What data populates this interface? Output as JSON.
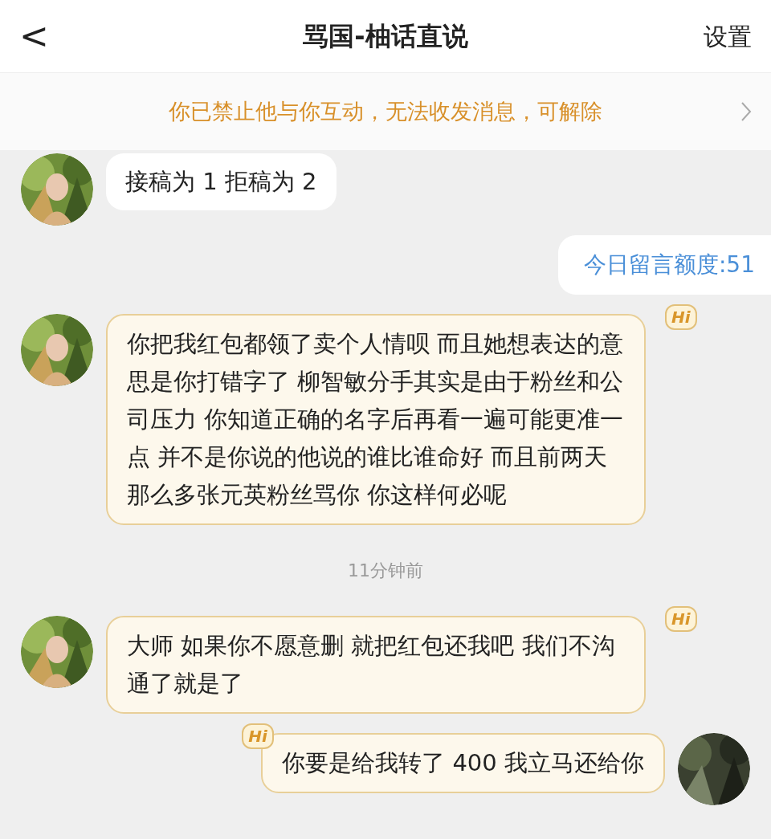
{
  "header": {
    "back": "<",
    "title": "骂国-柚话直说",
    "settings": "设置"
  },
  "banner": {
    "text": "你已禁止他与你互动，无法收发消息，可解除"
  },
  "messages": [
    {
      "kind": "plain",
      "outgoing": false,
      "text": "接稿为 1 拒稿为 2"
    },
    {
      "kind": "quota",
      "text": "今日留言额度:51"
    },
    {
      "kind": "hi",
      "outgoing": false,
      "badge": "Hi",
      "text": "你把我红包都领了卖个人情呗 而且她想表达的意思是你打错字了 柳智敏分手其实是由于粉丝和公司压力 你知道正确的名字后再看一遍可能更准一点 并不是你说的他说的谁比谁命好 而且前两天那么多张元英粉丝骂你 你这样何必呢"
    },
    {
      "kind": "time",
      "text": "11分钟前"
    },
    {
      "kind": "hi",
      "outgoing": false,
      "badge": "Hi",
      "text": "大师 如果你不愿意删 就把红包还我吧 我们不沟通了就是了"
    },
    {
      "kind": "hi",
      "outgoing": true,
      "badge": "Hi",
      "text": "你要是给我转了 400 我立马还给你"
    }
  ]
}
